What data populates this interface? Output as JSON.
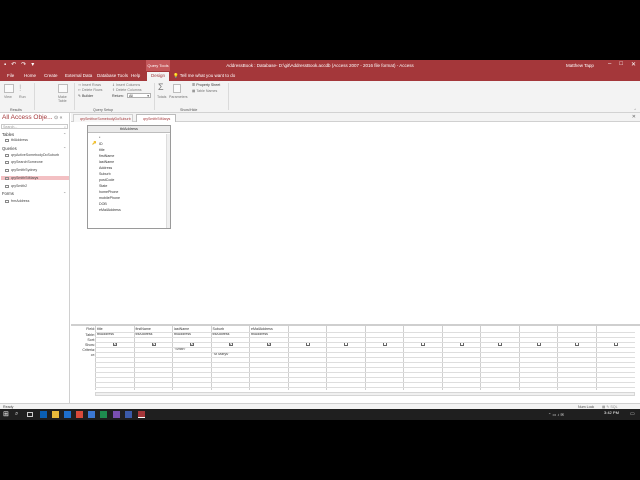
{
  "window": {
    "title": "AddressBook : Database- D:\\git\\AddressBook.accdb (Access 2007 - 2016 file format) - Access",
    "context_tab": "Query Tools",
    "user": "Matthew Tapp",
    "tell_me": "Tell me what you want to do"
  },
  "ribbon_tabs": [
    "File",
    "Home",
    "Create",
    "External Data",
    "Database Tools",
    "Help",
    "Design"
  ],
  "ribbon": {
    "results": {
      "view": "View",
      "run": "Run",
      "group": "Results"
    },
    "query_type": {
      "make_table": "Make Table",
      "group": "Query Type"
    },
    "query_setup": {
      "insert_rows": "Insert Rows",
      "delete_rows": "Delete Rows",
      "builder": "Builder",
      "insert_columns": "Insert Columns",
      "delete_columns": "Delete Columns",
      "return_label": "Return:",
      "return_value": "All",
      "group": "Query Setup"
    },
    "show_hide": {
      "totals": "Totals",
      "parameters": "Parameters",
      "property_sheet": "Property Sheet",
      "table_names": "Table Names",
      "group": "Show/Hide"
    }
  },
  "nav": {
    "header": "All Access Obje...",
    "search_placeholder": "Search...",
    "sections": {
      "tables": "Tables",
      "queries": "Queries",
      "forms": "Forms"
    },
    "tables": [
      "tblAddress"
    ],
    "queries": [
      "qryActiveSomebodyDoSuburb",
      "qrySearchSomeone",
      "qrySmithSydney",
      "qrySmithStMarys",
      "qrySmith2"
    ],
    "forms": [
      "frmAddress"
    ]
  },
  "doc_tabs": [
    "qrySmithorSomebodyDoSuburb",
    "qrySmithStMarys"
  ],
  "field_list": {
    "table": "tblAddress",
    "fields": [
      "*",
      "ID",
      "title",
      "firstName",
      "lastName",
      "Address",
      "Suburb",
      "postCode",
      "State",
      "homePhone",
      "mobilePhone",
      "DOB",
      "eMailAddress"
    ]
  },
  "grid": {
    "row_labels": [
      "Field:",
      "Table:",
      "Sort:",
      "Show:",
      "Criteria:",
      "or:"
    ],
    "columns": [
      {
        "field": "title",
        "table": "tblAddress",
        "show": true,
        "criteria": "",
        "or": ""
      },
      {
        "field": "firstName",
        "table": "tblAddress",
        "show": true,
        "criteria": "",
        "or": ""
      },
      {
        "field": "lastName",
        "table": "tblAddress",
        "show": true,
        "criteria": "\"Smith\"",
        "or": ""
      },
      {
        "field": "Suburb",
        "table": "tblAddress",
        "show": true,
        "criteria": "",
        "or": "\"St Marys\""
      },
      {
        "field": "eMailAddress",
        "table": "tblAddress",
        "show": true,
        "criteria": "",
        "or": ""
      },
      {
        "field": "",
        "table": "",
        "show": false,
        "criteria": "",
        "or": ""
      },
      {
        "field": "",
        "table": "",
        "show": false,
        "criteria": "",
        "or": ""
      },
      {
        "field": "",
        "table": "",
        "show": false,
        "criteria": "",
        "or": ""
      },
      {
        "field": "",
        "table": "",
        "show": false,
        "criteria": "",
        "or": ""
      },
      {
        "field": "",
        "table": "",
        "show": false,
        "criteria": "",
        "or": ""
      },
      {
        "field": "",
        "table": "",
        "show": false,
        "criteria": "",
        "or": ""
      },
      {
        "field": "",
        "table": "",
        "show": false,
        "criteria": "",
        "or": ""
      },
      {
        "field": "",
        "table": "",
        "show": false,
        "criteria": "",
        "or": ""
      },
      {
        "field": "",
        "table": "",
        "show": false,
        "criteria": "",
        "or": ""
      }
    ]
  },
  "status": {
    "left": "Ready",
    "right": "Num Lock"
  },
  "taskbar": {
    "time": "3:42 PM"
  },
  "colors": {
    "accent": "#a4373a",
    "selected": "#f3c0c3"
  }
}
